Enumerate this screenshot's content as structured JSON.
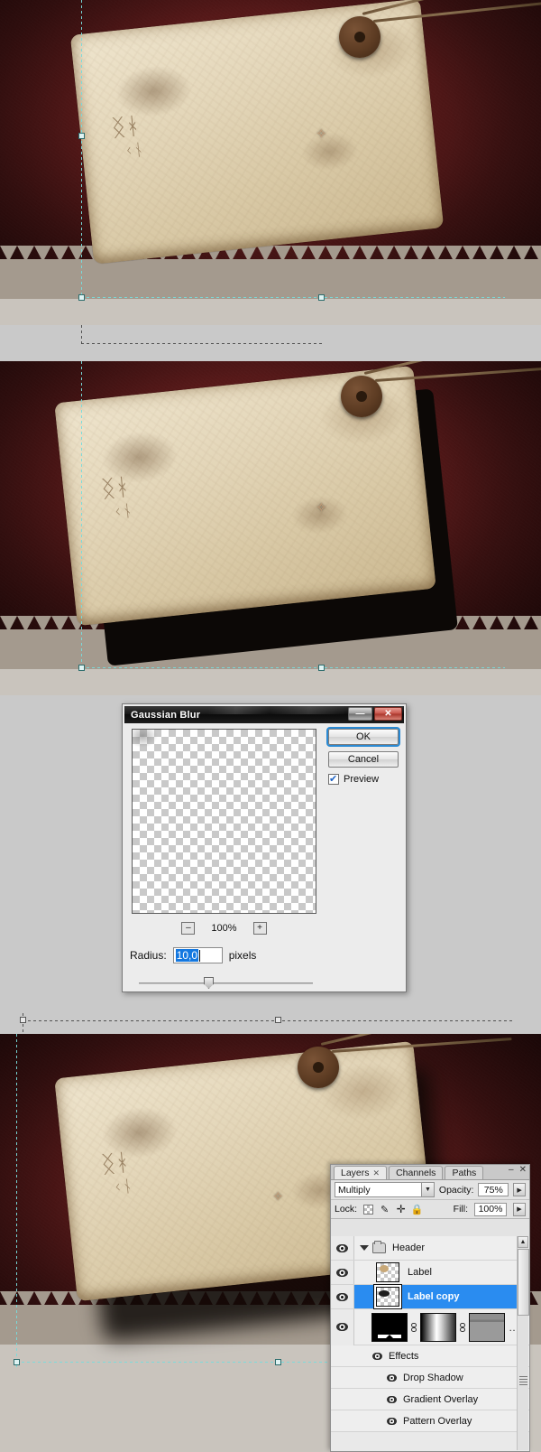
{
  "app": "Adobe Photoshop",
  "dialog": {
    "title": "Gaussian Blur",
    "window_buttons": {
      "minimize": "—",
      "close": "✕"
    },
    "buttons": {
      "ok": "OK",
      "cancel": "Cancel"
    },
    "preview": {
      "label": "Preview",
      "checked": true
    },
    "zoom": {
      "out": "–",
      "in": "+",
      "level": "100%"
    },
    "radius": {
      "label": "Radius:",
      "value": "10,0",
      "units": "pixels"
    }
  },
  "panel": {
    "tabs": [
      {
        "label": "Layers",
        "close": "✕",
        "active": true
      },
      {
        "label": "Channels",
        "active": false
      },
      {
        "label": "Paths",
        "active": false
      }
    ],
    "window_buttons": {
      "minimize": "–",
      "close": "✕"
    },
    "blend_mode": "Multiply",
    "opacity_label": "Opacity:",
    "opacity_value": "75%",
    "lock_label": "Lock:",
    "lock_icons": [
      "lock-transparency-icon",
      "lock-image-pixels-icon",
      "lock-position-icon",
      "lock-all-icon"
    ],
    "fill_label": "Fill:",
    "fill_value": "100%",
    "layers": [
      {
        "name": "Header",
        "type": "group",
        "visible": true,
        "expanded": true
      },
      {
        "name": "Label",
        "type": "layer",
        "visible": true,
        "selected": false
      },
      {
        "name": "Label copy",
        "type": "layer",
        "visible": true,
        "selected": true
      },
      {
        "name": "",
        "type": "adjustment-stack",
        "visible": true,
        "selected": false
      }
    ],
    "effects": {
      "label": "Effects",
      "items": [
        "Drop Shadow",
        "Gradient Overlay",
        "Pattern Overlay"
      ]
    }
  },
  "canvas": {
    "panels": [
      {
        "state": "before-blur"
      },
      {
        "state": "after-transform"
      },
      {
        "state": "with-blurred-shadow"
      }
    ],
    "marker": "✧"
  },
  "colors": {
    "selection_blue": "#2a8cf0",
    "field_highlight": "#1478e0",
    "guide_cyan": "#78dcdc",
    "tag_paper": "#e4d7ba",
    "backdrop_red": "#5a1a1a",
    "panel_gray": "#e3e3e3"
  }
}
